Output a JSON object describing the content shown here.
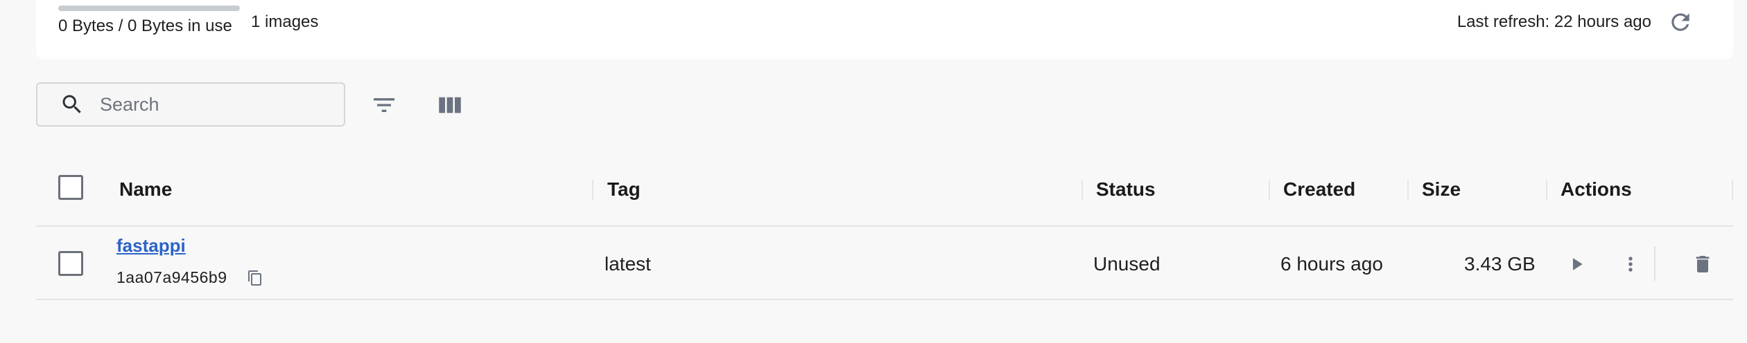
{
  "summary": {
    "usage_fraction": 0,
    "usage_text": "0 Bytes / 0 Bytes in use",
    "images_count": "1 images",
    "last_refresh": "Last refresh: 22 hours ago"
  },
  "toolbar": {
    "search_placeholder": "Search",
    "filter_icon": "filter-icon",
    "columns_icon": "view-column-icon"
  },
  "table": {
    "columns": {
      "name": "Name",
      "tag": "Tag",
      "status": "Status",
      "created": "Created",
      "size": "Size",
      "actions": "Actions"
    },
    "rows": [
      {
        "name": "fastappi",
        "id": "1aa07a9456b9",
        "tag": "latest",
        "status": "Unused",
        "created": "6 hours ago",
        "size": "3.43 GB"
      }
    ]
  },
  "colors": {
    "link": "#2b63c9",
    "icon": "#6b7280",
    "card": "#ffffff",
    "background": "#f8f8f8"
  }
}
